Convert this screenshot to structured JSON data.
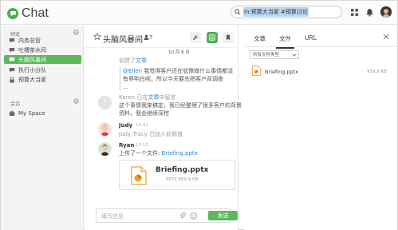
{
  "app": {
    "title": "Chat"
  },
  "search": {
    "query": "in:预算大当家 #预算讨论"
  },
  "sidebar": {
    "channels_header": "频道",
    "channels": [
      {
        "label": "内务总管",
        "icon": "chat-icon"
      },
      {
        "label": "吐槽茶水间",
        "icon": "chat-icon"
      },
      {
        "label": "头脑风暴间",
        "icon": "chat-icon",
        "active": true
      },
      {
        "label": "执行小分队",
        "icon": "chat-icon"
      },
      {
        "label": "预算大当家",
        "icon": "lock-icon"
      }
    ],
    "conversations_header": "会话",
    "conversations": [
      {
        "label": "My Space",
        "icon": "briefcase-icon"
      }
    ]
  },
  "chat": {
    "title": "头脑风暴间",
    "member_count": "7",
    "date_separator": "10 月 9 日",
    "messages": {
      "created_prefix": "创建了",
      "created_link": "文章",
      "quote_mention": "@Ellen",
      "quote_line1": "我觉得客户还在犹豫做什么事情都没",
      "quote_line2": "有界明白呢。所以今天要先把客户背调查",
      "quote_line3": "...",
      "karen_name": "Karen",
      "karen_mid": "已在",
      "karen_link": "文章",
      "karen_suffix": "中留言",
      "karen_line1": "这个事情我来搞定，我已经整理了很多客户的背景",
      "karen_line2": "资料，我会继续深挖",
      "judy_name": "Judy",
      "judy_time": "12:41",
      "judy_text": "Judy,Tracy 已加入此频道",
      "ryan_name": "Ryan",
      "ryan_time": "15:13",
      "ryan_text_prefix": "上传了一个文件:",
      "ryan_file_link": "Briefing.pptx"
    },
    "file_card": {
      "name": "Briefing.pptx",
      "meta": "PPTX 959.9 KB"
    },
    "composer": {
      "placeholder": "填写信息",
      "send_label": "发送"
    }
  },
  "panel": {
    "tabs": [
      "文章",
      "文件",
      "URL"
    ],
    "active_tab": "文件",
    "filter_label": "所有文件类型",
    "files": [
      {
        "name": "Briefing.pptx",
        "size": "959.9 KB"
      }
    ]
  },
  "colors": {
    "accent": "#4caf50",
    "active_item": "#5cb85c",
    "link": "#2a85d0",
    "file_orange": "#f0a030"
  }
}
